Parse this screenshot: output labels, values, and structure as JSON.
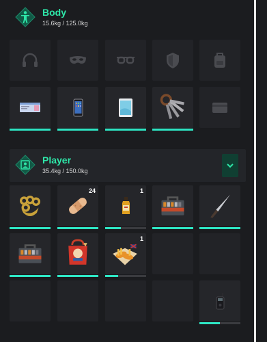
{
  "body_section": {
    "title": "Body",
    "weight": "15.6kg / 125.0kg"
  },
  "player_section": {
    "title": "Player",
    "weight": "35.4kg / 150.0kg"
  },
  "colors": {
    "accent": "#2ee6a8",
    "bar": "#2ee6c4",
    "chevron_bg": "#103f32"
  },
  "body_slots": [
    {
      "name": "headphones-slot",
      "icon": "headphones-icon",
      "empty": true
    },
    {
      "name": "mask-slot",
      "icon": "mask-icon",
      "empty": true
    },
    {
      "name": "glasses-slot",
      "icon": "glasses-icon",
      "empty": true
    },
    {
      "name": "armor-slot",
      "icon": "shield-icon",
      "empty": true
    },
    {
      "name": "bag-slot",
      "icon": "backpack-icon",
      "empty": true
    },
    {
      "name": "ticket-slot",
      "icon": "ticket-icon",
      "fill": 1.0
    },
    {
      "name": "phone-slot",
      "icon": "phone-icon",
      "fill": 1.0
    },
    {
      "name": "tablet-slot",
      "icon": "tablet-icon",
      "fill": 1.0
    },
    {
      "name": "keys-slot",
      "icon": "keys-icon",
      "fill": 1.0
    },
    {
      "name": "card-slot",
      "icon": "card-icon",
      "empty": true
    }
  ],
  "player_slots": [
    {
      "name": "brass-knuckles-slot",
      "icon": "brass-knuckles-icon",
      "fill": 1.0,
      "count": ""
    },
    {
      "name": "bandage-slot",
      "icon": "bandage-icon",
      "fill": 1.0,
      "count": "24"
    },
    {
      "name": "whiskey-slot",
      "icon": "bottle-icon",
      "fill": 0.38,
      "count": "1"
    },
    {
      "name": "toolbox-slot-1",
      "icon": "toolbox-icon",
      "fill": 1.0,
      "count": ""
    },
    {
      "name": "knife-slot",
      "icon": "knife-icon",
      "fill": 1.0,
      "count": ""
    },
    {
      "name": "toolbox-slot-2",
      "icon": "toolbox-icon",
      "fill": 1.0,
      "count": ""
    },
    {
      "name": "takeout-bag-slot",
      "icon": "takeout-bag-icon",
      "fill": 1.0,
      "count": ""
    },
    {
      "name": "fish-chips-slot",
      "icon": "fish-chips-icon",
      "fill": 0.32,
      "count": "1"
    },
    {
      "name": "empty-slot-9",
      "empty": true
    },
    {
      "name": "empty-slot-10",
      "empty": true
    },
    {
      "name": "empty-slot-11",
      "empty": true
    },
    {
      "name": "empty-slot-12",
      "empty": true
    },
    {
      "name": "empty-slot-13",
      "empty": true
    },
    {
      "name": "empty-slot-14",
      "empty": true
    },
    {
      "name": "radio-slot",
      "icon": "radio-icon",
      "fill": 0.5,
      "count": ""
    }
  ]
}
